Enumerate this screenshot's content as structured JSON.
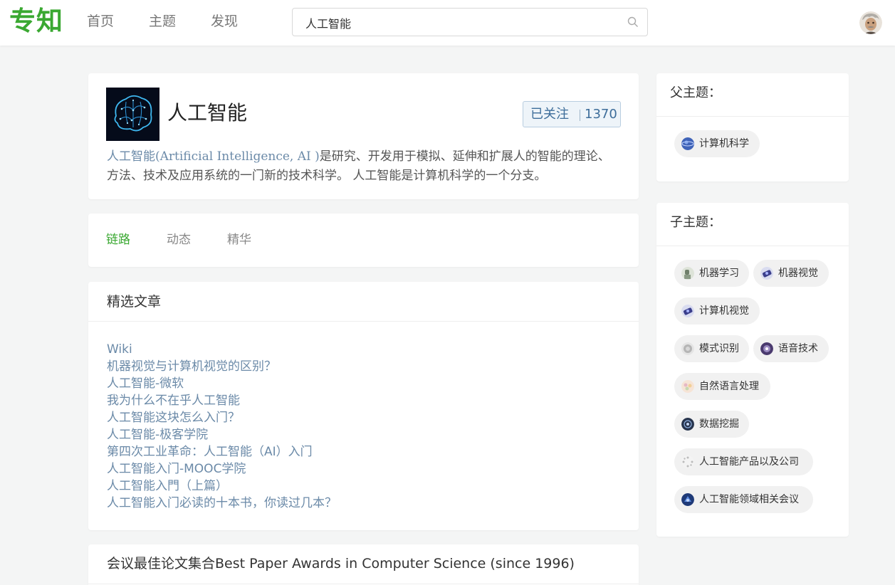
{
  "header": {
    "logo": "专知",
    "nav": [
      "首页",
      "主题",
      "发现"
    ],
    "search_value": "人工智能"
  },
  "topic": {
    "title": "人工智能",
    "follow_label": "已关注",
    "follow_count": "1370",
    "desc_highlight": "人工智能(Artificial Intelligence, AI )",
    "desc_rest": "是研究、开发用于模拟、延伸和扩展人的智能的理论、方法、技术及应用系统的一门新的技术科学。 人工智能是计算机科学的一个分支。"
  },
  "tabs": [
    {
      "label": "链路",
      "active": true
    },
    {
      "label": "动态",
      "active": false
    },
    {
      "label": "精华",
      "active": false
    }
  ],
  "featured": {
    "title": "精选文章",
    "articles": [
      "Wiki",
      "机器视觉与计算机视觉的区别？",
      "人工智能-微软",
      "我为什么不在乎人工智能",
      "人工智能这块怎么入门？",
      "人工智能-极客学院",
      "第四次工业革命：人工智能（AI）入门",
      "人工智能入门-MOOC学院",
      "人工智能入門（上篇）",
      "人工智能入门必读的十本书，你读过几本？"
    ]
  },
  "best_papers": {
    "title": "会议最佳论文集合Best Paper Awards in Computer Science (since 1996)"
  },
  "sidebar": {
    "parent_title": "父主题：",
    "parents": [
      {
        "label": "计算机科学",
        "icon": "globe-icon",
        "color": "#3f63b8"
      }
    ],
    "child_title": "子主题：",
    "children": [
      {
        "label": "机器学习",
        "icon": "robot-icon",
        "color": "#6f7f6a"
      },
      {
        "label": "机器视觉",
        "icon": "camera-icon",
        "color": "#3b3f8c"
      },
      {
        "label": "计算机视觉",
        "icon": "camera-icon",
        "color": "#3b3f8c"
      },
      {
        "label": "模式识别",
        "icon": "pattern-icon",
        "color": "#b5b5b5"
      },
      {
        "label": "语音技术",
        "icon": "sound-icon",
        "color": "#4a3a6e"
      },
      {
        "label": "自然语言处理",
        "icon": "language-icon",
        "color": "#e6b8c4"
      },
      {
        "label": "数据挖掘",
        "icon": "data-icon",
        "color": "#27344d"
      },
      {
        "label": "人工智能产品以及公司",
        "icon": "product-icon",
        "color": "#c8c8c8"
      },
      {
        "label": "人工智能领域相关会议",
        "icon": "conference-icon",
        "color": "#1e3a78"
      }
    ]
  }
}
